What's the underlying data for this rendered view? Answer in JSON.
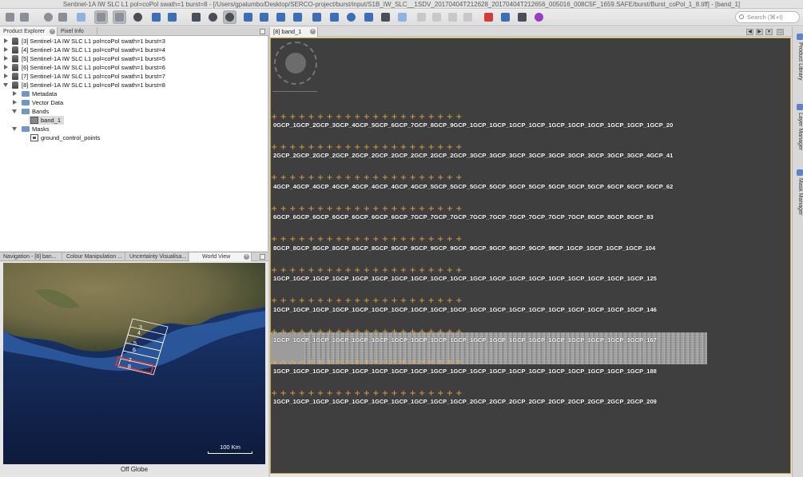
{
  "window": {
    "title": "Sentinel-1A IW SLC L1 pol=coPol swath=1 burst=8 - [/Users/gpalumbo/Desktop/SERCO-project/burst/input/S1B_IW_SLC__1SDV_20170404T212628_20170404T212656_005016_008C5F_1659.SAFE/burst/Burst_coPol_1_8.tiff] - [band_1]"
  },
  "toolbar": {
    "search_placeholder": "Search (⌘+I)",
    "icons": [
      "open-product-icon",
      "save-product-icon",
      "session-icon",
      "graph-icon",
      "band-maths-icon",
      "layers-icon",
      "pin-manager-icon",
      "gcp-manager-icon",
      "select-tool-icon",
      "pan-tool-icon",
      "zoom-tool-icon",
      "pin-placing-icon",
      "gcp-placing-icon",
      "range-finder-icon",
      "magic-wand-icon",
      "draw-rectangle-icon",
      "draw-polygon-icon",
      "draw-ellipse-icon",
      "draw-line-icon",
      "spectrum-icon",
      "measure-icon",
      "tile-evenly-icon",
      "tile-horizontal-icon",
      "tile-vertical-icon",
      "tile-single-icon",
      "satellite-icon",
      "graph-builder-icon",
      "binary-icon",
      "plugin-icon"
    ]
  },
  "product_explorer": {
    "tabs": [
      "Product Explorer",
      "Pixel Info"
    ],
    "products": [
      "[3] Sentinel-1A IW SLC L1 pol=coPol swath=1 burst=3",
      "[4] Sentinel-1A IW SLC L1 pol=coPol swath=1 burst=4",
      "[5] Sentinel-1A IW SLC L1 pol=coPol swath=1 burst=5",
      "[6] Sentinel-1A IW SLC L1 pol=coPol swath=1 burst=6",
      "[7] Sentinel-1A IW SLC L1 pol=coPol swath=1 burst=7",
      "[8] Sentinel-1A IW SLC L1 pol=coPol swath=1 burst=8"
    ],
    "expanded_children": {
      "metadata": "Metadata",
      "vector_data": "Vector Data",
      "bands": "Bands",
      "band_1": "band_1",
      "masks": "Masks",
      "gcp_mask": "ground_control_points"
    }
  },
  "lower_panel": {
    "tabs": [
      "Navigation - [8] ban...",
      "Colour Manipulation ...",
      "Uncertainty Visualisa...",
      "World View"
    ],
    "active_tab": "World View",
    "world_view": {
      "scale_label": "100 Km",
      "footer_text": "Off Globe",
      "footprint_labels": [
        "3",
        "4",
        "5",
        "6",
        "7",
        "8"
      ]
    }
  },
  "image_view": {
    "tab_label": "[8] band_1",
    "gcp_rows": [
      "0GCP_1GCP_2GCP_3GCP_4GCP_5GCP_6GCP_7GCP_8GCP_9GCP_1GCP_1GCP_1GCP_1GCP_1GCP_1GCP_1GCP_1GCP_1GCP_1GCP_20",
      "2GCP_2GCP_2GCP_2GCP_2GCP_2GCP_2GCP_2GCP_2GCP_2GCP_3GCP_3GCP_3GCP_3GCP_3GCP_3GCP_3GCP_3GCP_3GCP_4GCP_41",
      "4GCP_4GCP_4GCP_4GCP_4GCP_4GCP_4GCP_4GCP_5GCP_5GCP_5GCP_5GCP_5GCP_5GCP_5GCP_5GCP_5GCP_6GCP_6GCP_6GCP_62",
      "6GCP_6GCP_6GCP_6GCP_6GCP_6GCP_6GCP_7GCP_7GCP_7GCP_7GCP_7GCP_7GCP_7GCP_7GCP_7GCP_8GCP_8GCP_8GCP_83",
      "8GCP_8GCP_8GCP_8GCP_8GCP_8GCP_9GCP_9GCP_9GCP_9GCP_9GCP_9GCP_9GCP_9GCP_99CP_1GCP_1GCP_1GCP_1GCP_104",
      "1GCP_1GCP_1GCP_1GCP_1GCP_1GCP_1GCP_1GCP_1GCP_1GCP_1GCP_1GCP_1GCP_1GCP_1GCP_1GCP_1GCP_1GCP_1GCP_125",
      "1GCP_1GCP_1GCP_1GCP_1GCP_1GCP_1GCP_1GCP_1GCP_1GCP_1GCP_1GCP_1GCP_1GCP_1GCP_1GCP_1GCP_1GCP_1GCP_146",
      "1GCP_1GCP_1GCP_1GCP_1GCP_1GCP_1GCP_1GCP_1GCP_1GCP_1GCP_1GCP_1GCP_1GCP_1GCP_1GCP_1GCP_1GCP_1GCP_167",
      "1GCP_1GCP_1GCP_1GCP_1GCP_1GCP_1GCP_1GCP_1GCP_1GCP_1GCP_1GCP_1GCP_1GCP_1GCP_1GCP_1GCP_1GCP_1GCP_188",
      "1GCP_1GCP_1GCP_1GCP_1GCP_1GCP_1GCP_1GCP_1GCP_1GCP_2GCP_2GCP_2GCP_2GCP_2GCP_2GCP_2GCP_2GCP_2GCP_209"
    ],
    "cross_row": "+    +    +    +    +    +    +    +    +    +    +    +    +    +    +    +    +    +    +    +    +"
  },
  "right_sidebar": {
    "tools": [
      "Product Library",
      "Layer Manager",
      "Mask Manager"
    ]
  },
  "colors": {
    "canvas_bg": "#3f3f3f",
    "gcp_marker": "#e8a33a",
    "selected_burst": "#e0392f",
    "active_frame": "#c9a43a"
  }
}
